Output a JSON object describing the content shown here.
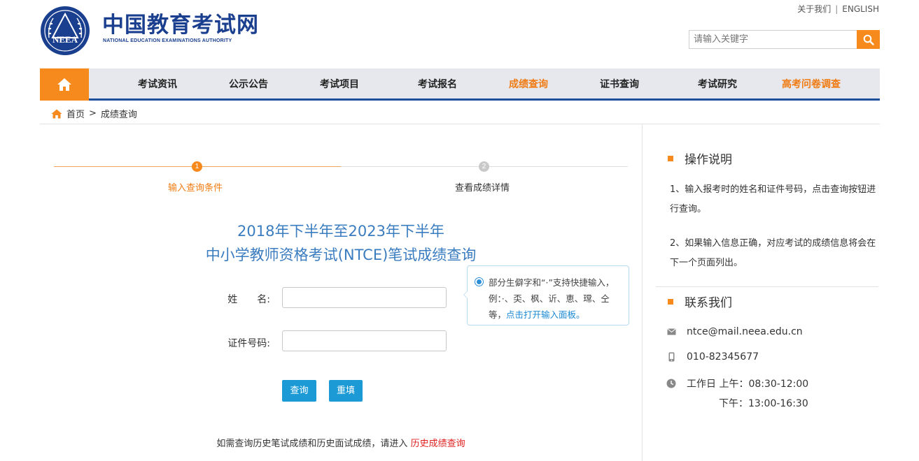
{
  "header": {
    "brand_cn": "中国教育考试网",
    "brand_en": "NATIONAL EDUCATION EXAMINATIONS AUTHORITY",
    "logo_text": "NEEA",
    "about_link": "关于我们",
    "separator": "|",
    "english_link": "ENGLISH",
    "search_placeholder": "请输入关键字"
  },
  "nav": {
    "items": [
      {
        "label": "考试资讯"
      },
      {
        "label": "公示公告"
      },
      {
        "label": "考试项目"
      },
      {
        "label": "考试报名"
      },
      {
        "label": "成绩查询"
      },
      {
        "label": "证书查询"
      },
      {
        "label": "考试研究"
      },
      {
        "label": "高考问卷调查"
      }
    ],
    "accent_color": "#f78a1d",
    "border_color": "#1e4f9c"
  },
  "breadcrumb": {
    "home": "首页",
    "sep": ">",
    "current": "成绩查询"
  },
  "steps": [
    {
      "num": "1",
      "label": "输入查询条件"
    },
    {
      "num": "2",
      "label": "查看成绩详情"
    }
  ],
  "form": {
    "title_line1": "2018年下半年至2023年下半年",
    "title_line2": "中小学教师资格考试(NTCE)笔试成绩查询",
    "name_label": "姓　　名:",
    "name_value": "",
    "id_label": "证件号码:",
    "id_value": "",
    "submit": "查询",
    "reset": "重填",
    "tip_text": "部分生僻字和“·”支持快捷输入，例：·、奀、枫、䜣、恵、瑺、仝等，",
    "tip_link": "点击打开输入面板。",
    "history_text": "如需查询历史笔试成绩和历史面试成绩，请进入",
    "history_link": "历史成绩查询"
  },
  "sidebar": {
    "ops_title": "操作说明",
    "ops_1": "1、输入报考时的姓名和证件号码，点击查询按钮进行查询。",
    "ops_2": "2、如果输入信息正确，对应考试的成绩信息将会在下一个页面列出。",
    "contact_title": "联系我们",
    "email": "ntce@mail.neea.edu.cn",
    "phone": "010-82345677",
    "hours_am": "工作日 上午：08:30-12:00",
    "hours_pm": "下午：13:00-16:30"
  }
}
